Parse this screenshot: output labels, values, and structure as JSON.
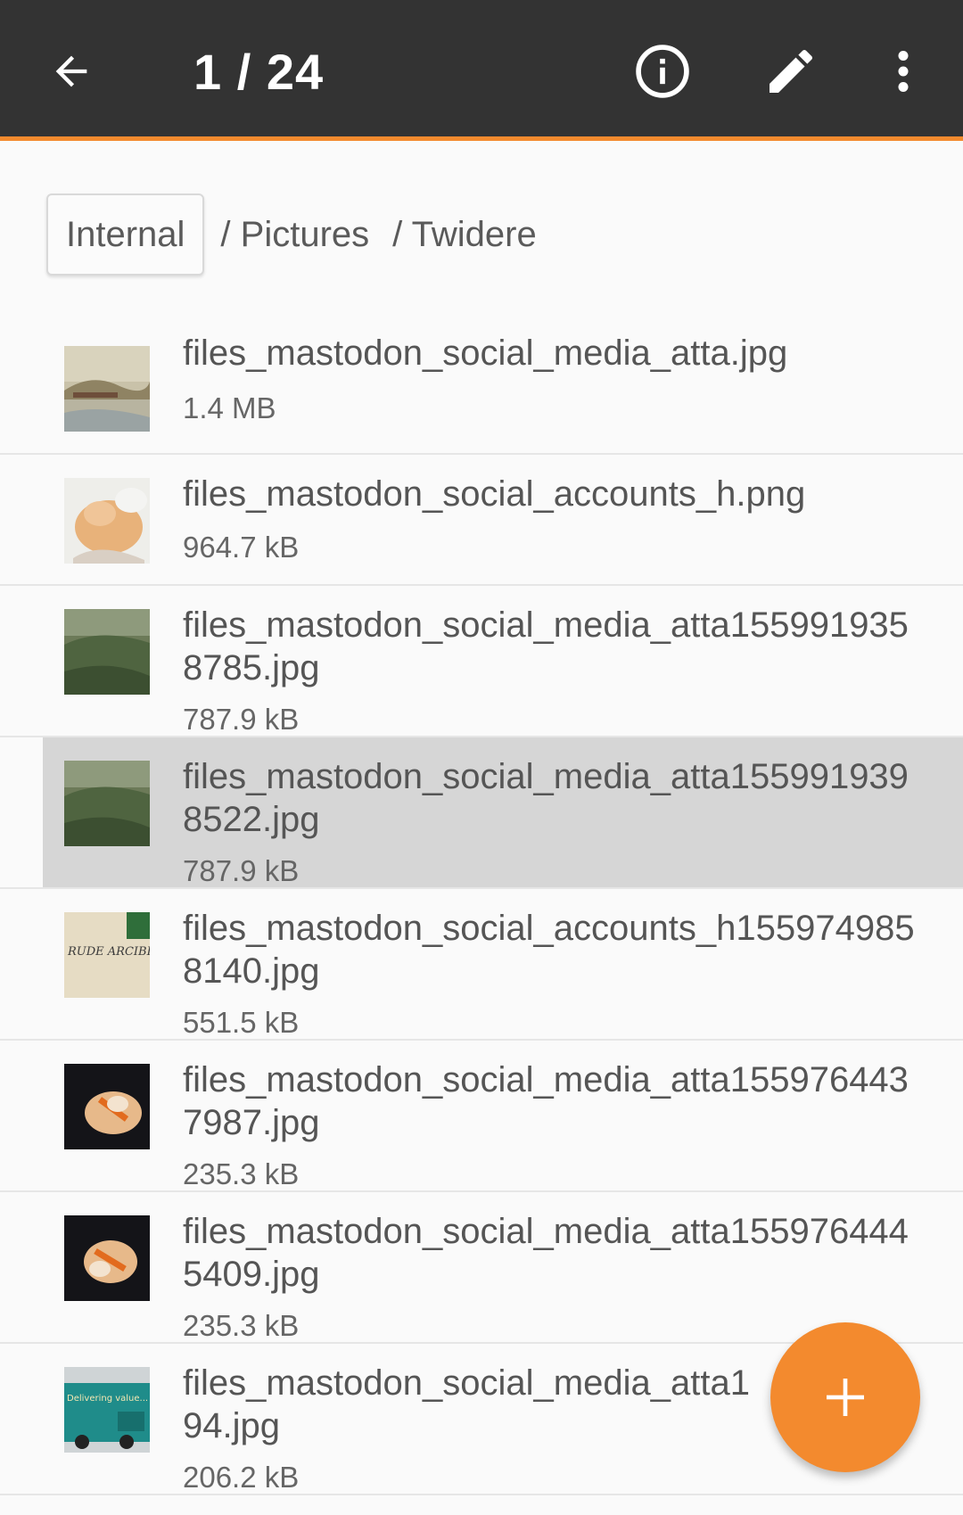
{
  "appbar": {
    "title": "1 / 24",
    "icons": {
      "back": "arrow-back-icon",
      "info": "info-icon",
      "edit": "pencil-icon",
      "more": "more-vert-icon"
    }
  },
  "breadcrumb": {
    "root": "Internal",
    "parts": [
      "/ Pictures",
      "/ Twidere"
    ]
  },
  "files": [
    {
      "name": "files_mastodon_social_media_atta.jpg",
      "size": "1.4 MB"
    },
    {
      "name": "files_mastodon_social_accounts_h.png",
      "size": "964.7 kB"
    },
    {
      "name": "files_mastodon_social_media_atta1559919358785.jpg",
      "size": "787.9 kB"
    },
    {
      "name": "files_mastodon_social_media_atta1559919398522.jpg",
      "size": "787.9 kB",
      "selected": true
    },
    {
      "name": "files_mastodon_social_accounts_h1559749858140.jpg",
      "size": "551.5 kB",
      "thumb_text": "RUDE ARCIBELLA"
    },
    {
      "name": "files_mastodon_social_media_atta1559764437987.jpg",
      "size": "235.3 kB"
    },
    {
      "name": "files_mastodon_social_media_atta1559764445409.jpg",
      "size": "235.3 kB"
    },
    {
      "name": "files_mastodon_social_media_atta1        231994.jpg",
      "size": "206.2 kB",
      "thumb_text": "Delivering value..."
    }
  ],
  "fab": {
    "icon": "plus-icon"
  },
  "colors": {
    "accent": "#f38a2e",
    "appbar": "#333333",
    "selected_row": "#d6d6d6"
  }
}
